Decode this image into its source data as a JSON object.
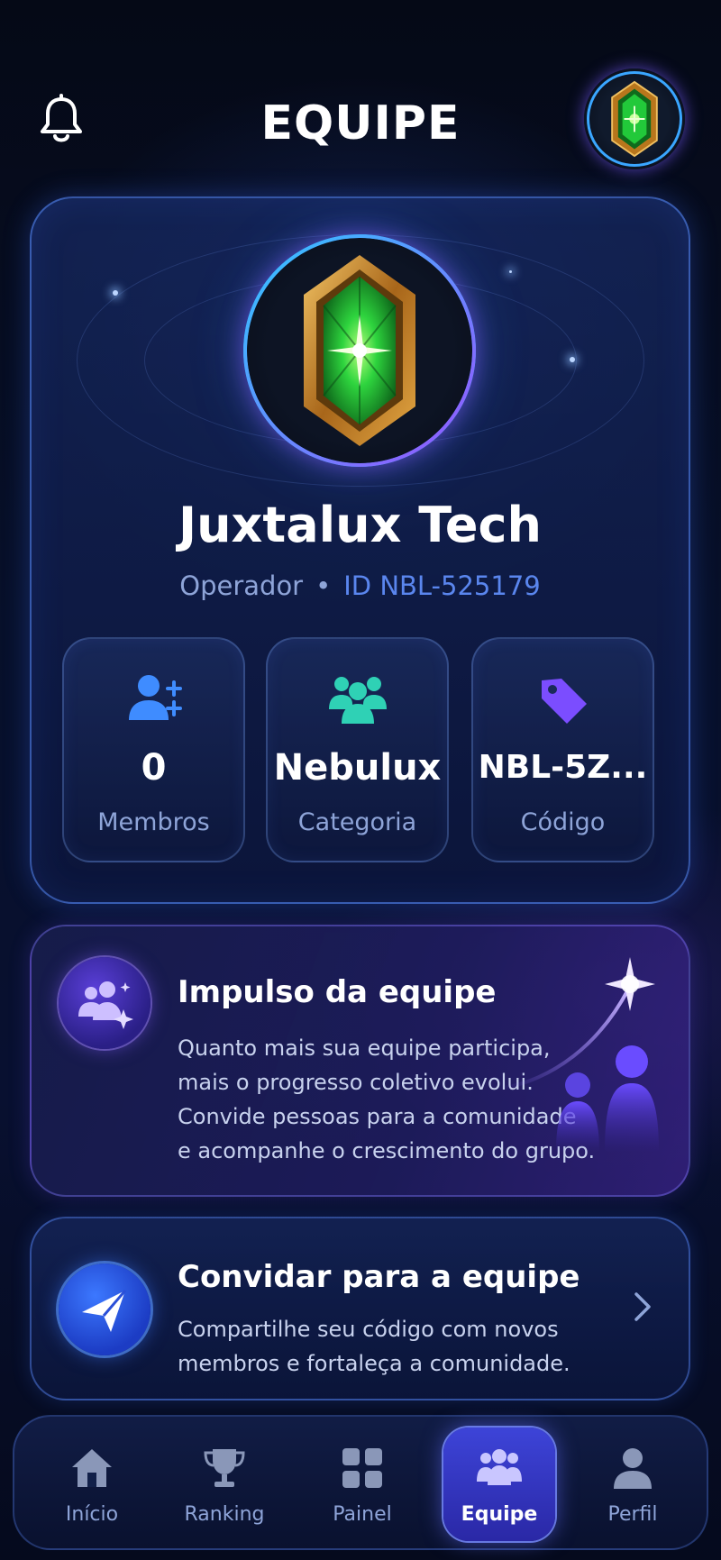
{
  "header": {
    "title": "EQUIPE",
    "bell_icon": "bell-icon",
    "avatar_icon": "emerald-badge-icon"
  },
  "profile": {
    "badge_icon": "emerald-badge-icon",
    "name": "Juxtalux Tech",
    "role": "Operador",
    "separator": "•",
    "id_text": "ID NBL-525179",
    "stats": [
      {
        "icon": "user-plus-icon",
        "value": "0",
        "label": "Membros"
      },
      {
        "icon": "group-icon",
        "value": "Nebulux",
        "label": "Categoria"
      },
      {
        "icon": "tag-icon",
        "value": "NBL-5Z...",
        "label": "Código"
      }
    ]
  },
  "boost": {
    "icon": "team-sparkle-icon",
    "title": "Impulso da equipe",
    "lines": [
      "Quanto mais sua equipe participa,",
      "mais o progresso coletivo evolui.",
      "Convide pessoas para a comunidade",
      "e acompanhe o crescimento do grupo."
    ]
  },
  "invite": {
    "icon": "send-icon",
    "title": "Convidar para a equipe",
    "lines": [
      "Compartilhe seu código com novos",
      "membros e fortaleça a comunidade."
    ]
  },
  "nav": {
    "items": [
      {
        "icon": "home-icon",
        "label": "Início",
        "active": false
      },
      {
        "icon": "trophy-icon",
        "label": "Ranking",
        "active": false
      },
      {
        "icon": "grid-icon",
        "label": "Painel",
        "active": false
      },
      {
        "icon": "team-icon",
        "label": "Equipe",
        "active": true
      },
      {
        "icon": "user-icon",
        "label": "Perfil",
        "active": false
      }
    ]
  },
  "colors": {
    "accent_blue": "#3aa6ff",
    "accent_purple": "#8a4dff",
    "emerald": "#22c93a",
    "gold": "#d99a2b",
    "muted_text": "#8ea4d8",
    "id_text": "#5a86ee"
  }
}
